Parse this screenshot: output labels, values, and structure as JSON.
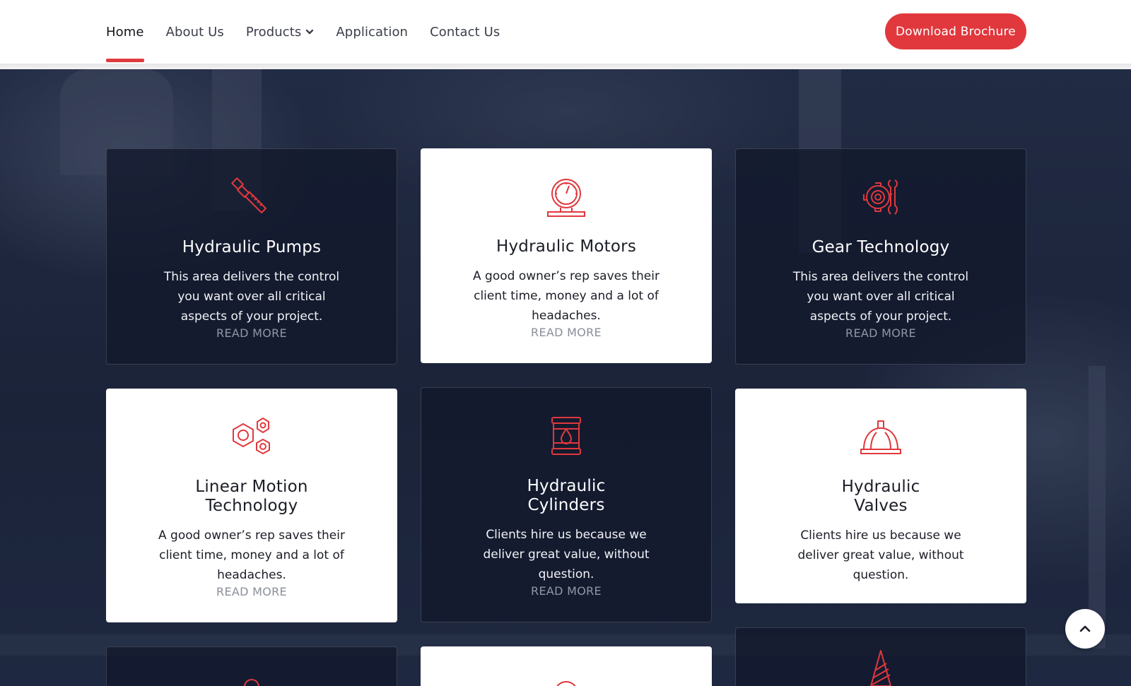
{
  "nav": {
    "items": [
      {
        "label": "Home",
        "active": true
      },
      {
        "label": "About Us"
      },
      {
        "label": "Products",
        "dropdown": true
      },
      {
        "label": "Application"
      },
      {
        "label": "Contact Us"
      }
    ],
    "cta_label": "Download Brochure"
  },
  "colors": {
    "accent": "#e0383d",
    "dark_bg": "#1a2238"
  },
  "cards": [
    {
      "title": "Hydraulic Pumps",
      "text": "This area delivers the control you want over all critical aspects of your project.",
      "link": "READ MORE",
      "icon": "pump-icon"
    },
    {
      "title": "Hydraulic Motors",
      "text": "A good owner’s rep saves their client time, money and a lot of headaches.",
      "link": "READ MORE",
      "icon": "pressure-gauge-icon"
    },
    {
      "title": "Gear Technology",
      "text": "This area delivers the control you want over all critical aspects of your project.",
      "link": "READ MORE",
      "icon": "gear-wrench-icon"
    },
    {
      "title": "Linear Motion Technology",
      "text": "A good owner’s rep saves their client time, money and a lot of headaches.",
      "link": "READ MORE",
      "icon": "hex-nuts-icon"
    },
    {
      "title": "Hydraulic Cylinders",
      "text": "Clients hire us because we deliver great value, without question.",
      "link": "READ MORE",
      "icon": "oil-barrel-icon"
    },
    {
      "title": "Hydraulic Valves",
      "text": "Clients hire us because we deliver great value, without question.",
      "icon": "hard-hat-icon"
    }
  ],
  "scroll_top": {
    "icon": "chevron-up-icon"
  }
}
